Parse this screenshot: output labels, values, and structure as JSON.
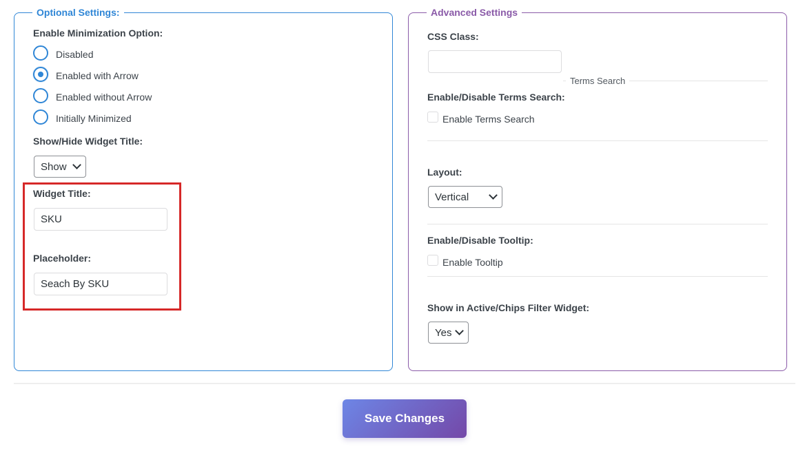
{
  "optional": {
    "legend": "Optional Settings:",
    "minimization_label": "Enable Minimization Option:",
    "radio_options": [
      "Disabled",
      "Enabled with Arrow",
      "Enabled without Arrow",
      "Initially Minimized"
    ],
    "selected_radio": "Enabled with Arrow",
    "show_hide_label": "Show/Hide Widget Title:",
    "show_hide_value": "Show",
    "widget_title_label": "Widget Title:",
    "widget_title_value": "SKU",
    "placeholder_label": "Placeholder:",
    "placeholder_value": "Seach By SKU"
  },
  "advanced": {
    "legend": "Advanced Settings",
    "css_class_label": "CSS Class:",
    "css_class_value": "",
    "terms_search_heading": "Terms Search",
    "terms_search_label": "Enable/Disable Terms Search:",
    "terms_search_checkbox": "Enable Terms Search",
    "layout_label": "Layout:",
    "layout_value": "Vertical",
    "tooltip_label": "Enable/Disable Tooltip:",
    "tooltip_checkbox": "Enable Tooltip",
    "chips_label": "Show in Active/Chips Filter Widget:",
    "chips_value": "Yes"
  },
  "save_label": "Save Changes",
  "colors": {
    "optional_border": "#2f86d6",
    "advanced_border": "#8a5aa8",
    "highlight": "#d62828",
    "button_gradient_start": "#6d86e6",
    "button_gradient_end": "#7448a8"
  }
}
